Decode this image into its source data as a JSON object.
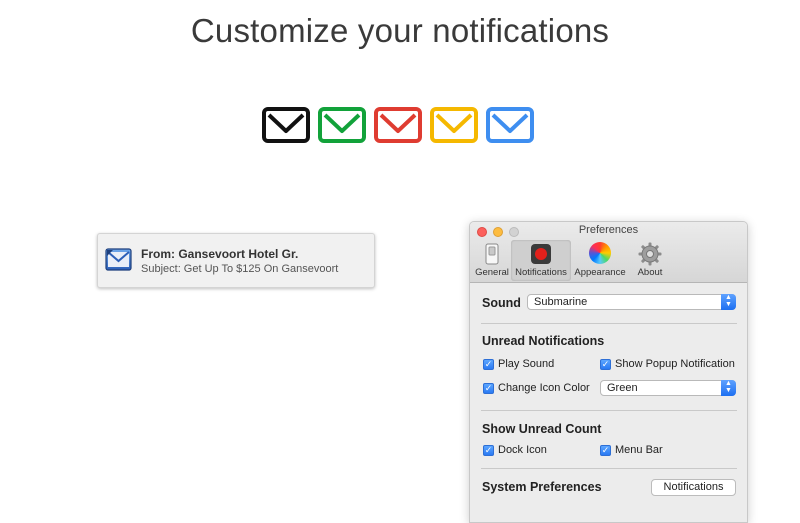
{
  "headline": "Customize your notifications",
  "envelopes": [
    {
      "color": "#111111",
      "icon": "mail-icon-black"
    },
    {
      "color": "#12a23a",
      "icon": "mail-icon-green"
    },
    {
      "color": "#df3c31",
      "icon": "mail-icon-red"
    },
    {
      "color": "#f5b800",
      "icon": "mail-icon-yellow"
    },
    {
      "color": "#3e8ef0",
      "icon": "mail-icon-blue"
    }
  ],
  "banner": {
    "title": "From: Gansevoort Hotel Gr.",
    "subject": "Subject: Get Up To $125 On Gansevoort",
    "icon": "mail-app-icon"
  },
  "window": {
    "title": "Preferences",
    "toolbar": [
      {
        "label": "General",
        "icon": "switch-icon",
        "selected": false
      },
      {
        "label": "Notifications",
        "icon": "record-icon",
        "selected": true
      },
      {
        "label": "Appearance",
        "icon": "color-wheel-icon",
        "selected": false
      },
      {
        "label": "About",
        "icon": "gear-icon",
        "selected": false
      }
    ],
    "sound": {
      "label": "Sound",
      "value": "Submarine"
    },
    "unread": {
      "heading": "Unread Notifications",
      "play_sound": {
        "label": "Play Sound",
        "checked": true
      },
      "show_popup": {
        "label": "Show Popup Notification",
        "checked": true
      },
      "change_icon_color": {
        "label": "Change Icon Color",
        "checked": true
      },
      "color_value": "Green"
    },
    "count": {
      "heading": "Show Unread Count",
      "dock_icon": {
        "label": "Dock Icon",
        "checked": true
      },
      "menu_bar": {
        "label": "Menu Bar",
        "checked": true
      }
    },
    "system": {
      "heading": "System Preferences",
      "button_label": "Notifications"
    }
  }
}
